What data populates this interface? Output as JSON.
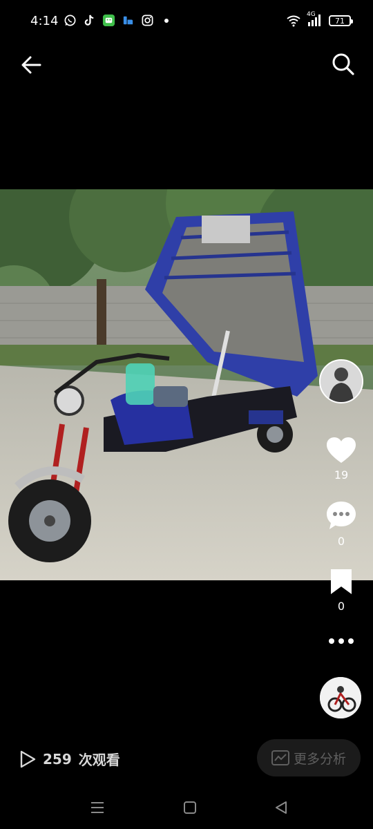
{
  "status_bar": {
    "time": "4:14",
    "network": "4G",
    "battery": "71",
    "app_icons": [
      "whatsapp-icon",
      "tiktok-icon",
      "wechat-icon",
      "app-icon",
      "instagram-icon"
    ]
  },
  "top_bar": {
    "back_icon": "arrow-left-icon",
    "search_icon": "search-icon"
  },
  "media": {
    "description_icon": "photo-tricycle"
  },
  "actions": {
    "likes": "19",
    "comments": "0",
    "saves": "0"
  },
  "footer": {
    "views_count": "259",
    "views_label": "次观看",
    "analysis_label": "更多分析"
  },
  "colors": {
    "background": "#000000",
    "truck_blue": "#2f3fa8",
    "button_bg": "#1b1b1b",
    "muted_text": "#5f5f5f"
  }
}
